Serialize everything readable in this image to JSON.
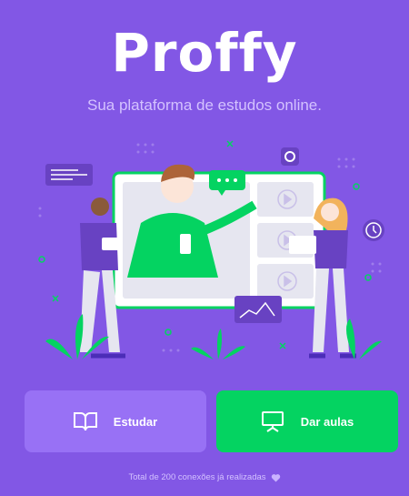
{
  "logo": {
    "text": "Proffy"
  },
  "tagline": "Sua plataforma de estudos online.",
  "actions": {
    "study": {
      "label": "Estudar",
      "icon": "book-open-icon",
      "color": "#9871F5"
    },
    "give_classes": {
      "label": "Dar aulas",
      "icon": "presentation-board-icon",
      "color": "#04D361"
    }
  },
  "footer": {
    "text": "Total de 200 conexões já realizadas",
    "icon": "heart-icon"
  },
  "colors": {
    "background": "#8257E5",
    "text_light": "#D4C2FF",
    "primary_light": "#9871F5",
    "secondary": "#04D361"
  }
}
